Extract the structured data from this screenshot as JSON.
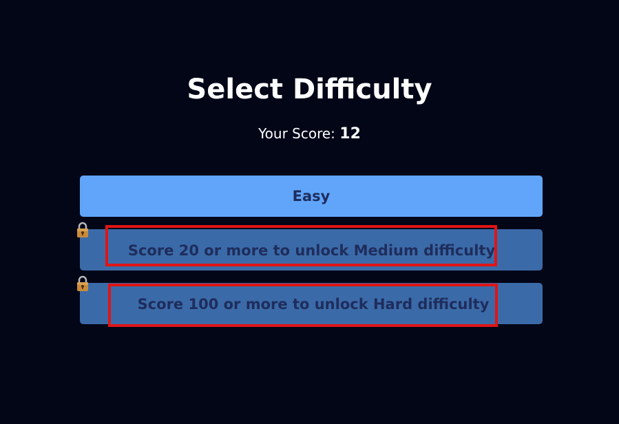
{
  "title": "Select Difficulty",
  "score": {
    "label": "Your Score: ",
    "value": "12"
  },
  "difficulties": [
    {
      "label": "Easy",
      "locked": false
    },
    {
      "label": "Score 20 or more to unlock Medium difficulty",
      "locked": true,
      "icon": "lock-icon"
    },
    {
      "label": "Score 100 or more to unlock Hard difficulty",
      "locked": true,
      "icon": "lock-icon"
    }
  ],
  "colors": {
    "background": "#020617",
    "easy_button": "#60a5fa",
    "locked_button": "#3b6aa8",
    "button_text": "#1e2d5c",
    "highlight": "#e11414"
  }
}
